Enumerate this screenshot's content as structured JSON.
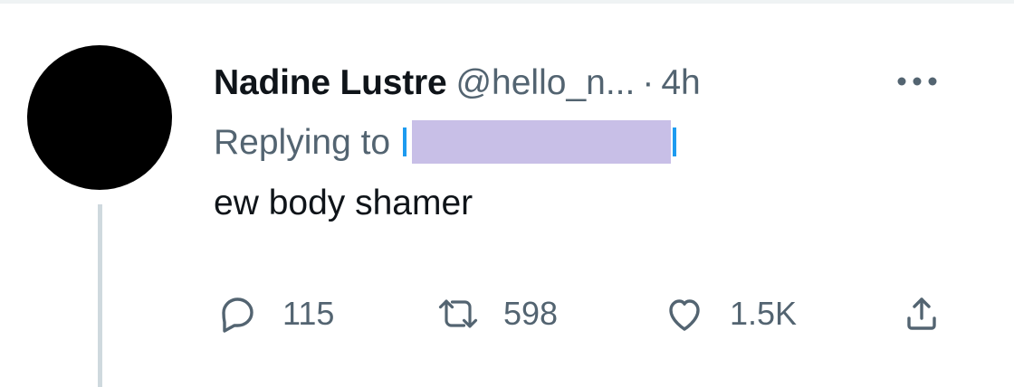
{
  "tweet": {
    "display_name": "Nadine Lustre",
    "handle": "@hello_n...",
    "separator": "·",
    "time": "4h",
    "replying_prefix": "Replying to",
    "text": "ew body shamer"
  },
  "actions": {
    "reply": {
      "count": "115",
      "icon": "reply-icon"
    },
    "retweet": {
      "count": "598",
      "icon": "retweet-icon"
    },
    "like": {
      "count": "1.5K",
      "icon": "heart-icon"
    },
    "share": {
      "icon": "share-icon"
    },
    "more": {
      "icon": "more-icon"
    }
  },
  "colors": {
    "text_primary": "#0f1419",
    "text_secondary": "#536471",
    "mention_blue": "#1d9bf0",
    "redaction_purple": "#c8bfe7",
    "thread_line": "#cfd9de",
    "avatar": "#000000"
  }
}
